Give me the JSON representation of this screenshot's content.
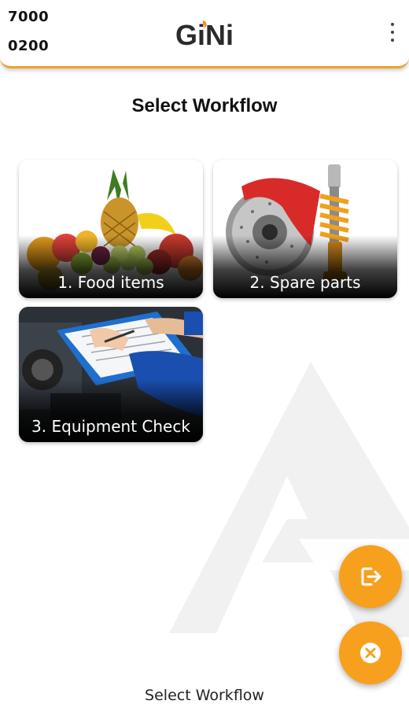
{
  "header": {
    "device_id_line1": "7000",
    "device_id_line2": "0200",
    "logo_text": "GiNi",
    "menu_icon": "kebab-menu-icon"
  },
  "title": "Select Workflow",
  "workflows": [
    {
      "label": "1. Food items",
      "image": "fruits-image"
    },
    {
      "label": "2. Spare parts",
      "image": "brake-disc-and-shock-image"
    },
    {
      "label": "3. Equipment Check",
      "image": "clipboard-inspection-image"
    }
  ],
  "fabs": {
    "exit_icon": "exit-icon",
    "close_icon": "close-circle-icon"
  },
  "footer_text": "Select Workflow",
  "colors": {
    "accent": "#f7a01e",
    "logo_dark": "#2b2b2b",
    "logo_flame": "#f08a1a"
  }
}
